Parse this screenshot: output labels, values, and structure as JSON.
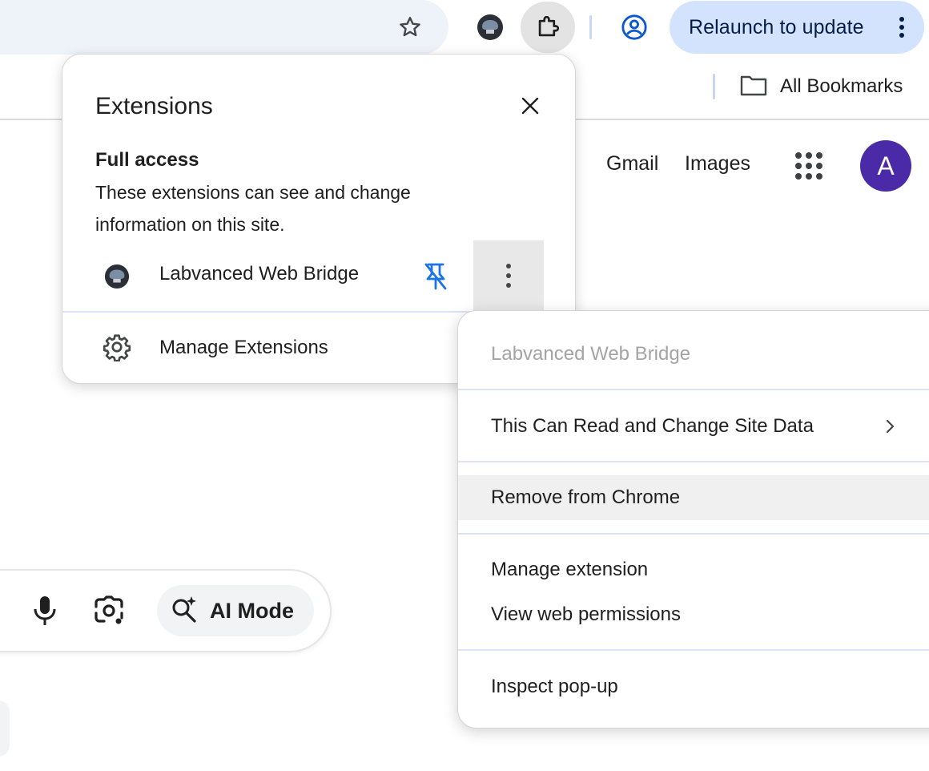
{
  "toolbar": {
    "relaunch_label": "Relaunch to update",
    "icons": [
      "bookmark-star-icon",
      "extension-brain-icon",
      "puzzle-icon",
      "profile-icon",
      "more-vert-icon"
    ]
  },
  "bookmarks_bar": {
    "all_bookmarks_label": "All Bookmarks"
  },
  "google": {
    "gmail_label": "Gmail",
    "images_label": "Images",
    "avatar_letter": "A",
    "avatar_color": "#4b2aa8",
    "ai_mode_label": "AI Mode"
  },
  "extensions_popup": {
    "title": "Extensions",
    "section_title": "Full access",
    "section_desc": "These extensions can see and change information on this site.",
    "extension_name": "Labvanced Web Bridge",
    "manage_label": "Manage Extensions",
    "pin_color": "#1a73e8"
  },
  "context_menu": {
    "header": "Labvanced Web Bridge",
    "site_access": "This Can Read and Change Site Data",
    "remove": "Remove from Chrome",
    "manage": "Manage extension",
    "permissions": "View web permissions",
    "inspect": "Inspect pop-up"
  }
}
